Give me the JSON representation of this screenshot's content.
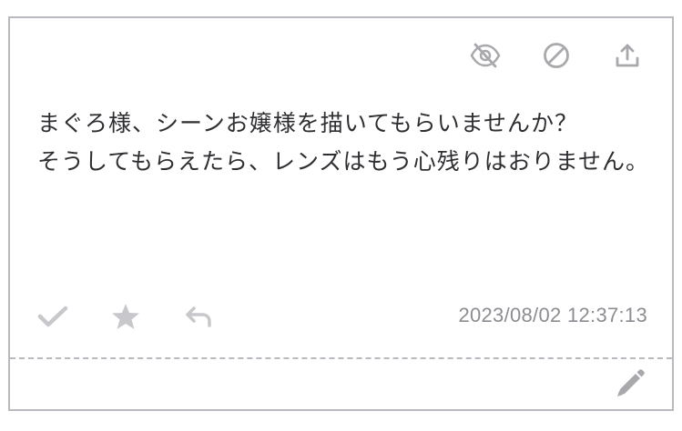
{
  "post": {
    "message": "まぐろ様、シーンお嬢様を描いてもらいませんか？\nそうしてもらえたら、レンズはもう心残りはおりません。",
    "timestamp": "2023/08/02 12:37:13"
  },
  "icons": {
    "top": [
      "eye-off-icon",
      "block-icon",
      "upload-icon"
    ],
    "bottom": [
      "check-icon",
      "star-icon",
      "reply-icon"
    ],
    "edit": "pencil-icon"
  },
  "colors": {
    "text": "#2f2f33",
    "muted_icon": "#a9a9ad",
    "light_icon": "#c8c8cc",
    "border": "#b9b9bf",
    "timestamp": "#8c8c92"
  }
}
